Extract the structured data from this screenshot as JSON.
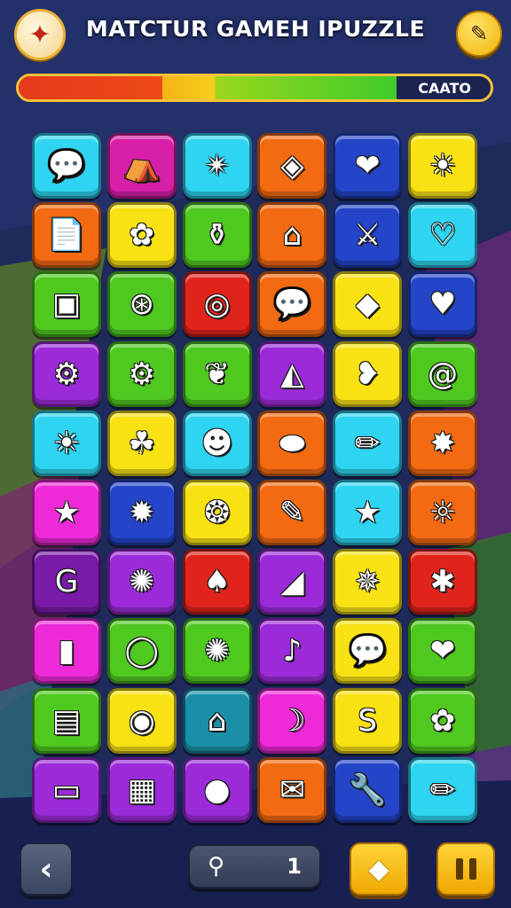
{
  "header": {
    "title": "MATCTUR GAMEH IPUZZLE",
    "logo_icon": "compass-star-icon",
    "edit_icon": "pencil-icon"
  },
  "progress": {
    "label": "CAATO",
    "fraction": 0.8
  },
  "colors": {
    "cyan": "#2ed4f0",
    "magenta": "#d81fa8",
    "orange": "#f26a12",
    "blue": "#2445c8",
    "yellow": "#f8e214",
    "red": "#e0241c",
    "green": "#4fc820",
    "purple": "#9b2bd8",
    "pink": "#ee2ad8",
    "darkpurple": "#7a1aa8",
    "teal": "#1a8fa8",
    "accent": "#f6c23a"
  },
  "board": {
    "rows": [
      [
        {
          "color": "cyan",
          "icon": "speech-bubble-icon",
          "glyph": "💬"
        },
        {
          "color": "magenta",
          "icon": "tent-icon",
          "glyph": "⛺"
        },
        {
          "color": "cyan",
          "icon": "pinwheel-icon",
          "glyph": "✴"
        },
        {
          "color": "orange",
          "icon": "kite-icon",
          "glyph": "◈"
        },
        {
          "color": "blue",
          "icon": "heart-icon",
          "glyph": "❤"
        },
        {
          "color": "yellow",
          "icon": "sun-icon",
          "glyph": "☀"
        }
      ],
      [
        {
          "color": "orange",
          "icon": "document-icon",
          "glyph": "📄"
        },
        {
          "color": "yellow",
          "icon": "gem-icon",
          "glyph": "✿"
        },
        {
          "color": "green",
          "icon": "bottle-icon",
          "glyph": "⚱"
        },
        {
          "color": "orange",
          "icon": "house-icon",
          "glyph": "⌂"
        },
        {
          "color": "blue",
          "icon": "bow-icon",
          "glyph": "⚔"
        },
        {
          "color": "cyan",
          "icon": "heart-icon",
          "glyph": "♡"
        }
      ],
      [
        {
          "color": "green",
          "icon": "toolbox-icon",
          "glyph": "▣"
        },
        {
          "color": "green",
          "icon": "wheel-icon",
          "glyph": "⊛"
        },
        {
          "color": "red",
          "icon": "spiral-icon",
          "glyph": "◎"
        },
        {
          "color": "orange",
          "icon": "speech-bubble-icon",
          "glyph": "💬"
        },
        {
          "color": "yellow",
          "icon": "fish-icon",
          "glyph": "◆"
        },
        {
          "color": "blue",
          "icon": "heart-icon",
          "glyph": "♥"
        }
      ],
      [
        {
          "color": "purple",
          "icon": "gear-icon",
          "glyph": "⚙"
        },
        {
          "color": "green",
          "icon": "gear-icon",
          "glyph": "⚙"
        },
        {
          "color": "green",
          "icon": "pear-icon",
          "glyph": "❦"
        },
        {
          "color": "purple",
          "icon": "fish-icon",
          "glyph": "◭"
        },
        {
          "color": "yellow",
          "icon": "heart-bubble-icon",
          "glyph": "❥"
        },
        {
          "color": "green",
          "icon": "swirl-icon",
          "glyph": "@"
        }
      ],
      [
        {
          "color": "cyan",
          "icon": "sun-icon",
          "glyph": "☀"
        },
        {
          "color": "yellow",
          "icon": "leaf-icon",
          "glyph": "☘"
        },
        {
          "color": "cyan",
          "icon": "face-icon",
          "glyph": "☻"
        },
        {
          "color": "orange",
          "icon": "blob-icon",
          "glyph": "⬬"
        },
        {
          "color": "cyan",
          "icon": "pencil-icon",
          "glyph": "✏"
        },
        {
          "color": "orange",
          "icon": "splat-icon",
          "glyph": "✸"
        }
      ],
      [
        {
          "color": "pink",
          "icon": "star-icon",
          "glyph": "★"
        },
        {
          "color": "blue",
          "icon": "gear-icon",
          "glyph": "✹"
        },
        {
          "color": "yellow",
          "icon": "bubble-icon",
          "glyph": "❂"
        },
        {
          "color": "orange",
          "icon": "pencil-icon",
          "glyph": "✎"
        },
        {
          "color": "cyan",
          "icon": "star-icon",
          "glyph": "★"
        },
        {
          "color": "orange",
          "icon": "sun-icon",
          "glyph": "☼"
        }
      ],
      [
        {
          "color": "darkpurple",
          "icon": "hook-icon",
          "glyph": "G"
        },
        {
          "color": "purple",
          "icon": "gear-icon",
          "glyph": "✺"
        },
        {
          "color": "red",
          "icon": "onion-icon",
          "glyph": "♠"
        },
        {
          "color": "purple",
          "icon": "ribbon-icon",
          "glyph": "◢"
        },
        {
          "color": "yellow",
          "icon": "sun-icon",
          "glyph": "✵"
        },
        {
          "color": "red",
          "icon": "splat-icon",
          "glyph": "✱"
        }
      ],
      [
        {
          "color": "pink",
          "icon": "bottle-icon",
          "glyph": "▮"
        },
        {
          "color": "green",
          "icon": "speech-bubble-icon",
          "glyph": "◯"
        },
        {
          "color": "green",
          "icon": "splat-icon",
          "glyph": "✺"
        },
        {
          "color": "purple",
          "icon": "lollipop-icon",
          "glyph": "♪"
        },
        {
          "color": "yellow",
          "icon": "speech-bubble-icon",
          "glyph": "💬"
        },
        {
          "color": "green",
          "icon": "heart-icon",
          "glyph": "❤"
        }
      ],
      [
        {
          "color": "green",
          "icon": "basket-icon",
          "glyph": "▤"
        },
        {
          "color": "yellow",
          "icon": "donut-icon",
          "glyph": "◉"
        },
        {
          "color": "teal",
          "icon": "house-icon",
          "glyph": "⌂"
        },
        {
          "color": "pink",
          "icon": "banana-icon",
          "glyph": "☽"
        },
        {
          "color": "yellow",
          "icon": "s-shape-icon",
          "glyph": "S"
        },
        {
          "color": "green",
          "icon": "flower-icon",
          "glyph": "✿"
        }
      ],
      [
        {
          "color": "purple",
          "icon": "purse-icon",
          "glyph": "▭"
        },
        {
          "color": "purple",
          "icon": "clapper-icon",
          "glyph": "▦"
        },
        {
          "color": "purple",
          "icon": "cookie-icon",
          "glyph": "●"
        },
        {
          "color": "orange",
          "icon": "envelope-icon",
          "glyph": "✉"
        },
        {
          "color": "blue",
          "icon": "wrench-icon",
          "glyph": "🔧"
        },
        {
          "color": "cyan",
          "icon": "pencil-icon",
          "glyph": "✏"
        }
      ]
    ]
  },
  "footer": {
    "back_icon": "chevron-left-icon",
    "back_glyph": "‹",
    "hint_icon": "magnifier-icon",
    "hint_glyph": "🔍",
    "hint_count": "1",
    "diamond_icon": "diamond-icon",
    "diamond_glyph": "◆",
    "pause_icon": "pause-icon"
  }
}
